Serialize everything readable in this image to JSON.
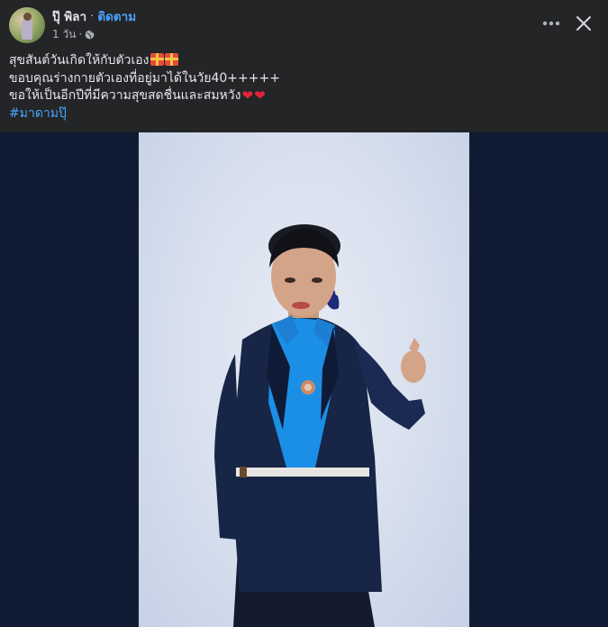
{
  "post": {
    "author_name": "ปุ๊ พิลา",
    "separator": "·",
    "follow_label": "ติดตาม",
    "timestamp": "1 วัน",
    "privacy_icon": "globe-icon",
    "lines": [
      "สุขสันต์วันเกิดให้กับตัวเอง",
      "ขอบคุณร่างกายตัวเองที่อยู่มาได้ในวัย40+++++",
      "ขอให้เป็นอีกปีที่มีความสุขสดชื่นและสมหวัง"
    ],
    "hashtag": "#มาดามปุ๊"
  },
  "header_actions": {
    "more_icon": "more-horizontal-icon",
    "close_icon": "close-icon"
  },
  "colors": {
    "background": "#242526",
    "link": "#4aa3ff",
    "photo_backdrop": "#0f1c33"
  }
}
